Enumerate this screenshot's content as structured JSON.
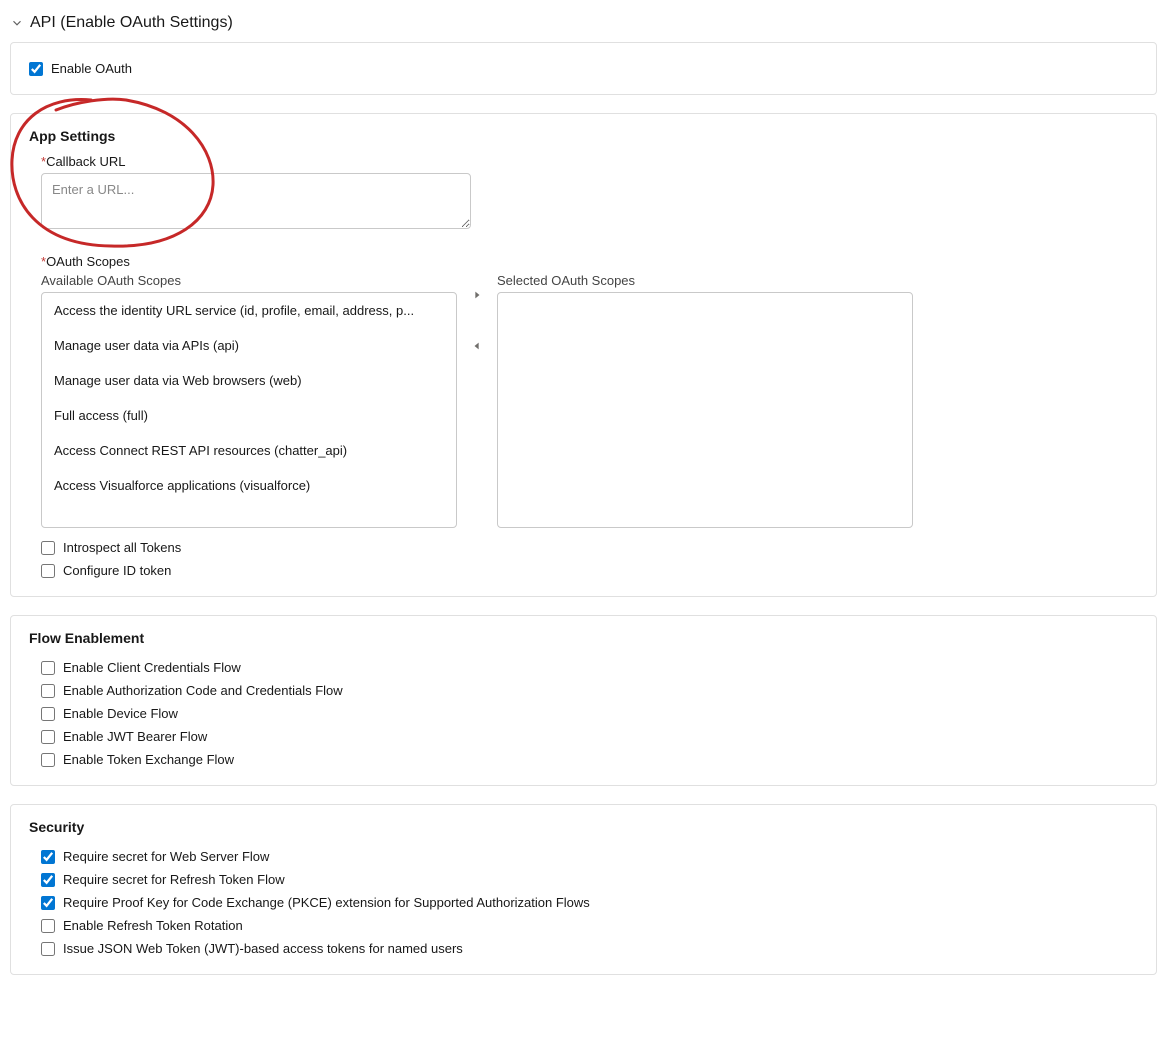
{
  "header": {
    "title": "API (Enable OAuth Settings)"
  },
  "enable_oauth": {
    "label": "Enable OAuth",
    "checked": true
  },
  "app_settings": {
    "title": "App Settings",
    "callback_url": {
      "label": "Callback URL",
      "placeholder": "Enter a URL...",
      "value": ""
    },
    "oauth_scopes_label": "OAuth Scopes",
    "available_label": "Available OAuth Scopes",
    "selected_label": "Selected OAuth Scopes",
    "available_scopes": [
      "Access the identity URL service (id, profile, email, address, p...",
      "Manage user data via APIs (api)",
      "Manage user data via Web browsers (web)",
      "Full access (full)",
      "Access Connect REST API resources (chatter_api)",
      "Access Visualforce applications (visualforce)"
    ],
    "selected_scopes": [],
    "introspect_label": "Introspect all Tokens",
    "introspect_checked": false,
    "configure_id_label": "Configure ID token",
    "configure_id_checked": false
  },
  "flow_enablement": {
    "title": "Flow Enablement",
    "items": [
      {
        "label": "Enable Client Credentials Flow",
        "checked": false
      },
      {
        "label": "Enable Authorization Code and Credentials Flow",
        "checked": false
      },
      {
        "label": "Enable Device Flow",
        "checked": false
      },
      {
        "label": "Enable JWT Bearer Flow",
        "checked": false
      },
      {
        "label": "Enable Token Exchange Flow",
        "checked": false
      }
    ]
  },
  "security": {
    "title": "Security",
    "items": [
      {
        "label": "Require secret for Web Server Flow",
        "checked": true
      },
      {
        "label": "Require secret for Refresh Token Flow",
        "checked": true
      },
      {
        "label": "Require Proof Key for Code Exchange (PKCE) extension for Supported Authorization Flows",
        "checked": true
      },
      {
        "label": "Enable Refresh Token Rotation",
        "checked": false
      },
      {
        "label": "Issue JSON Web Token (JWT)-based access tokens for named users",
        "checked": false
      }
    ]
  },
  "annotation": {
    "color": "#c62828"
  }
}
